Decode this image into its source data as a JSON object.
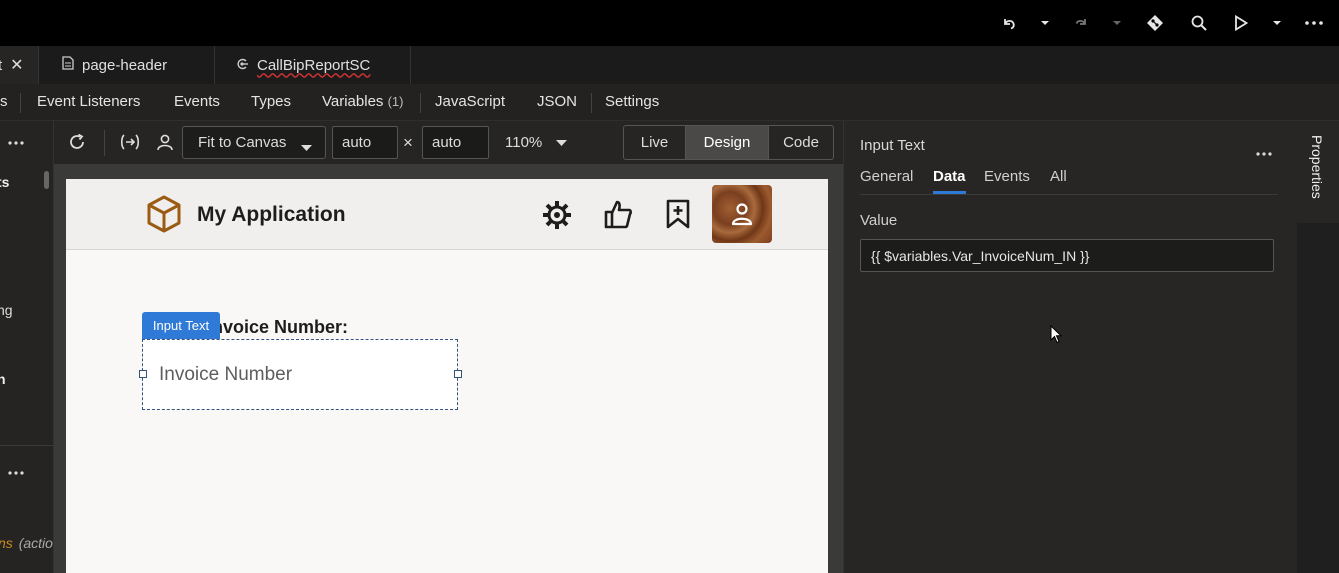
{
  "topbar": {
    "icons": [
      "undo-icon",
      "chevron-down-icon",
      "redo-icon",
      "chevron-down-icon",
      "git-icon",
      "search-icon",
      "run-icon",
      "chevron-down-icon",
      "more-icon"
    ]
  },
  "file_tabs": [
    {
      "label": "t",
      "closable": true
    },
    {
      "label": "page-header"
    },
    {
      "label": "CallBipReportSC"
    }
  ],
  "subnav": {
    "items": [
      "s",
      "Event Listeners",
      "Events",
      "Types",
      "Variables",
      "JavaScript",
      "JSON",
      "Settings"
    ],
    "variables_count": "(1)"
  },
  "left_panel": {
    "labels": [
      "ts",
      "ng",
      "n",
      "ns",
      "(actio"
    ]
  },
  "toolbar": {
    "fit_label": "Fit to Canvas",
    "width_value": "auto",
    "times": "×",
    "height_value": "auto",
    "zoom": "110%",
    "modes": [
      "Live",
      "Design",
      "Code"
    ],
    "active_mode": "Design"
  },
  "canvas": {
    "app_title": "My Application",
    "field_label_partial": "nvoice Number:",
    "component_badge": "Input Text",
    "input_placeholder": "Invoice Number"
  },
  "properties": {
    "title": "Input Text",
    "tabs": [
      "General",
      "Data",
      "Events",
      "All"
    ],
    "active_tab": "Data",
    "value_label": "Value",
    "value": "{{ $variables.Var_InvoiceNum_IN }}",
    "side_tab": "Properties"
  },
  "colors": {
    "accent": "#2f7ad6",
    "brand": "#9a5b13",
    "avatar": "#8a4d2a"
  }
}
